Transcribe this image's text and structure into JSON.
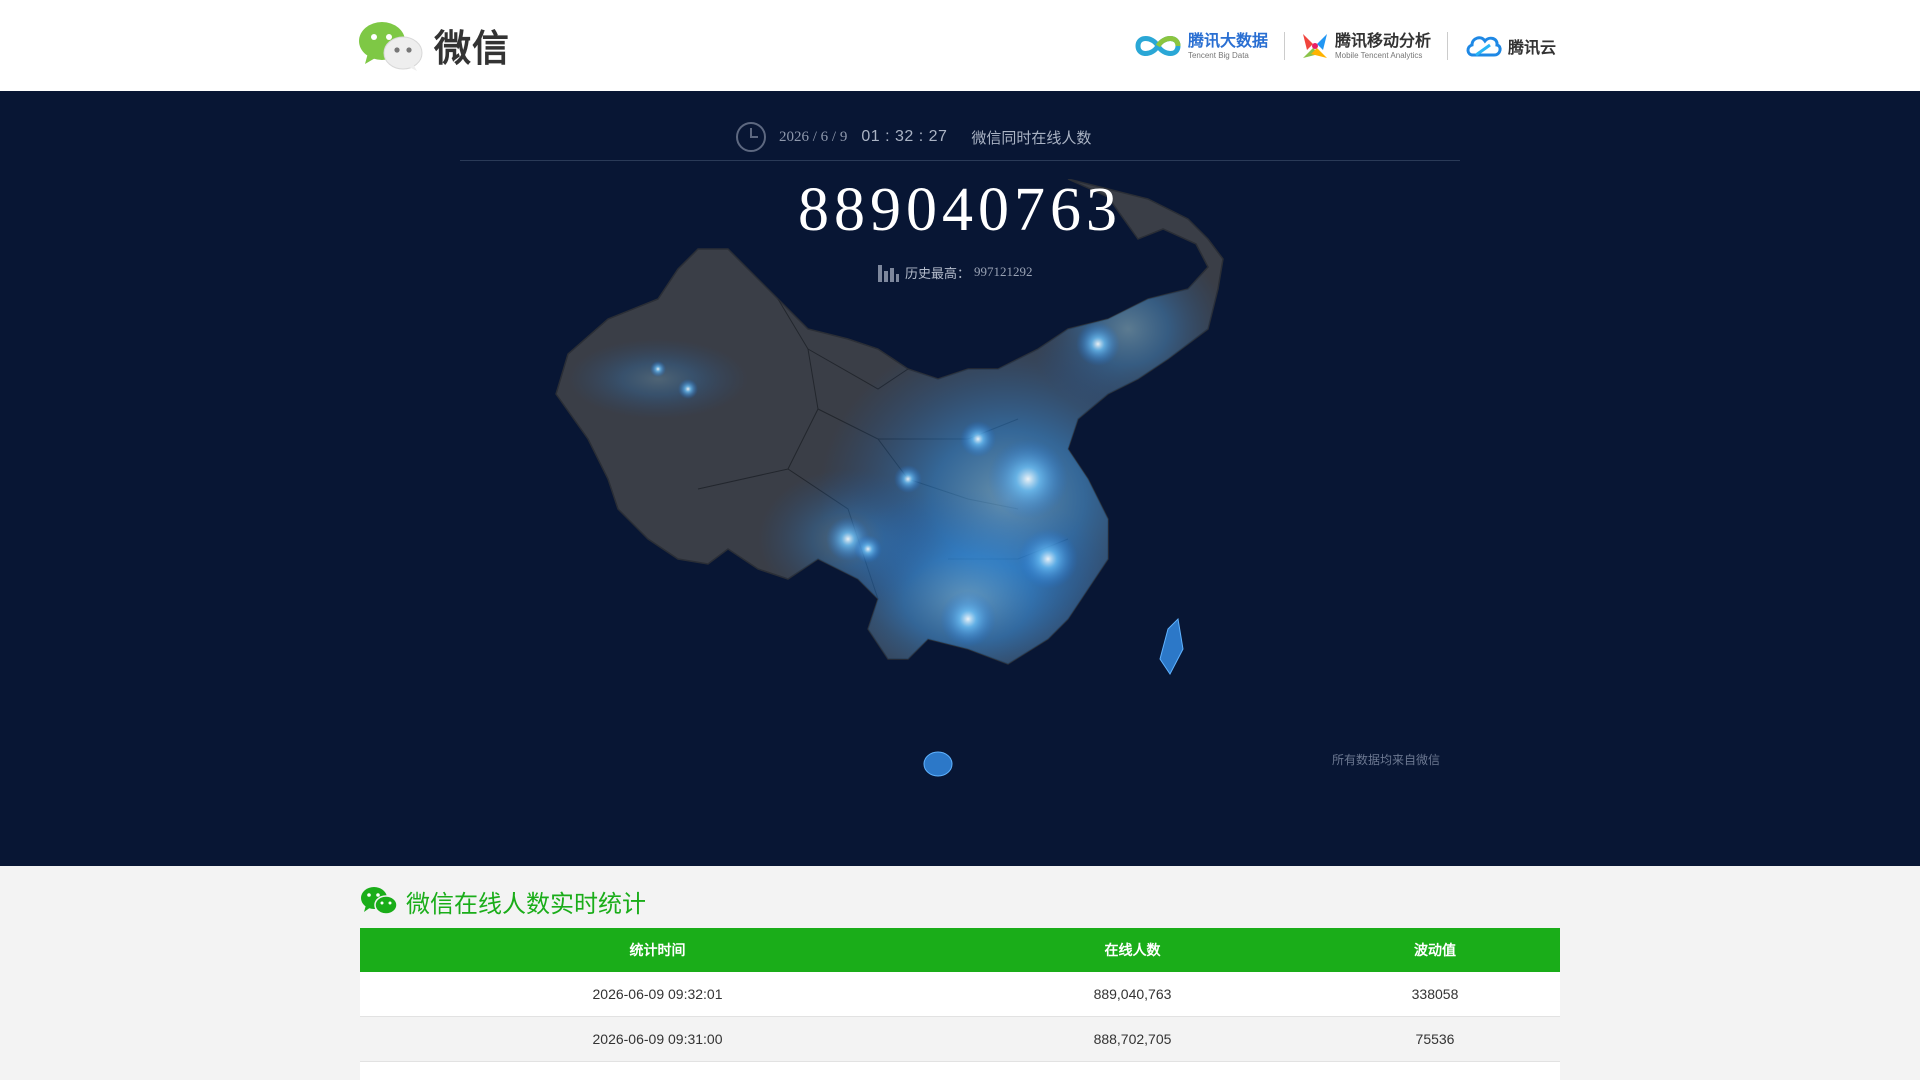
{
  "header": {
    "brand": {
      "title": "微信",
      "logo": "wechat-logo-icon"
    },
    "partners": [
      {
        "name": "腾讯大数据",
        "sub": "Tencent Big Data",
        "icon": "infinity-logo-icon"
      },
      {
        "name": "腾讯移动分析",
        "sub": "Mobile Tencent Analytics",
        "icon": "colorful-x-logo-icon"
      },
      {
        "name": "腾讯云",
        "sub": "",
        "icon": "cloud-logo-icon"
      }
    ]
  },
  "hero": {
    "date": "2026 / 6 / 9",
    "time": "01 : 32 : 27",
    "label": "微信同时在线人数",
    "online_count": "889040763",
    "record_label": "历史最高：",
    "record_value": "997121292",
    "source_note": "所有数据均来自微信",
    "icons": [
      "clock-icon",
      "bar-chart-icon"
    ]
  },
  "stats": {
    "title": "微信在线人数实时统计",
    "columns": [
      "统计时间",
      "在线人数",
      "波动值"
    ],
    "rows": [
      [
        "2026-06-09 09:32:01",
        "889,040,763",
        "338058"
      ],
      [
        "2026-06-09 09:31:00",
        "888,702,705",
        "75536"
      ]
    ]
  },
  "colors": {
    "brand_green": "#1aad19",
    "hero_bg": "#081634",
    "map_land": "#3a3e47",
    "light_blue": "#3aa0ff"
  }
}
